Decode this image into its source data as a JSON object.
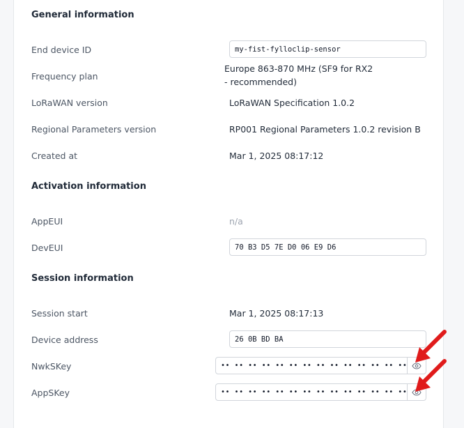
{
  "general": {
    "title": "General information",
    "end_device_id_label": "End device ID",
    "end_device_id_value": "my-fist-fylloclip-sensor",
    "frequency_plan_label": "Frequency plan",
    "frequency_plan_value": "Europe 863-870 MHz (SF9 for RX2 - recommended)",
    "lorawan_version_label": "LoRaWAN version",
    "lorawan_version_value": "LoRaWAN Specification 1.0.2",
    "regional_params_label": "Regional Parameters version",
    "regional_params_value": "RP001 Regional Parameters 1.0.2 revision B",
    "created_at_label": "Created at",
    "created_at_value": "Mar 1, 2025 08:17:12"
  },
  "activation": {
    "title": "Activation information",
    "appeui_label": "AppEUI",
    "appeui_value": "n/a",
    "deveui_label": "DevEUI",
    "deveui_value": "70 B3 D5 7E D0 06 E9 D6"
  },
  "session": {
    "title": "Session information",
    "session_start_label": "Session start",
    "session_start_value": "Mar 1, 2025 08:17:13",
    "device_address_label": "Device address",
    "device_address_value": "26 0B BD BA",
    "nwkskey_label": "NwkSKey",
    "nwkskey_value": "•• •• •• •• •• •• •• •• •• •• •• •• •• •• •• ••",
    "appskey_label": "AppSKey",
    "appskey_value": "•• •• •• •• •• •• •• •• •• •• •• •• •• •• •• ••"
  },
  "icons": {
    "reveal": "eye-icon",
    "annotation": "red-arrow"
  },
  "colors": {
    "annotation": "#e01b1b",
    "label": "#4b5563",
    "muted": "#9ca3af"
  }
}
